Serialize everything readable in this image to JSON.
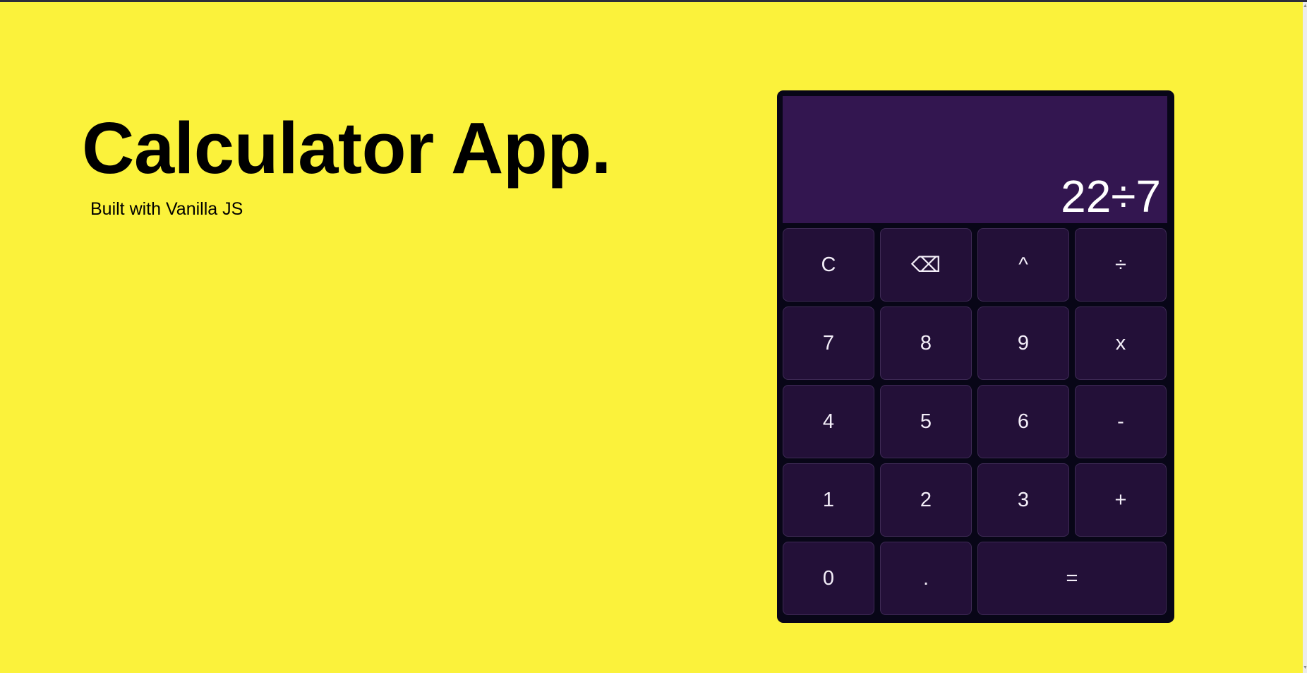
{
  "hero": {
    "title": "Calculator App.",
    "subtitle": "Built with Vanilla JS"
  },
  "calculator": {
    "display": "22÷7",
    "keys": [
      {
        "label": "C",
        "name": "clear-button"
      },
      {
        "label": "⌫",
        "name": "backspace-button"
      },
      {
        "label": "^",
        "name": "power-button"
      },
      {
        "label": "÷",
        "name": "divide-button"
      },
      {
        "label": "7",
        "name": "digit-7-button"
      },
      {
        "label": "8",
        "name": "digit-8-button"
      },
      {
        "label": "9",
        "name": "digit-9-button"
      },
      {
        "label": "x",
        "name": "multiply-button"
      },
      {
        "label": "4",
        "name": "digit-4-button"
      },
      {
        "label": "5",
        "name": "digit-5-button"
      },
      {
        "label": "6",
        "name": "digit-6-button"
      },
      {
        "label": "-",
        "name": "subtract-button"
      },
      {
        "label": "1",
        "name": "digit-1-button"
      },
      {
        "label": "2",
        "name": "digit-2-button"
      },
      {
        "label": "3",
        "name": "digit-3-button"
      },
      {
        "label": "+",
        "name": "add-button"
      },
      {
        "label": "0",
        "name": "digit-0-button"
      },
      {
        "label": ".",
        "name": "decimal-button"
      },
      {
        "label": "=",
        "name": "equals-button"
      }
    ]
  },
  "colors": {
    "page_background": "#fbf23b",
    "calculator_body": "#080617",
    "display_background": "#331650",
    "key_background": "#231038",
    "key_text": "#f3eef8"
  }
}
